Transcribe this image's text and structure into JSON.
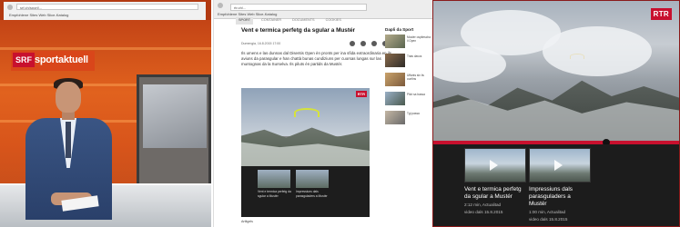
{
  "panel1": {
    "browser": {
      "url": "srf.ch/sport/...",
      "bookmarks": "Empfohlene Sites   Web Slice-Katalog"
    },
    "logo": {
      "brand": "SRF",
      "product": "sportaktuell"
    }
  },
  "panel2": {
    "browser": {
      "url": "rtr.ch/...",
      "bookmarks": "Empfohlene Sites   Web Slice-Katalog"
    },
    "nav": [
      "SPORT",
      "CONTAINER",
      "DOCUMENTS",
      "COOKIES"
    ],
    "article": {
      "headline": "Vent e termica perfetg da sgular a Mustér",
      "meta": "Dumengia, 16.8.2015 17:00",
      "body": "Ils umens e las dunnas dal Disentis Open èn pronts per ina sfida extraordinaria en ils aviuns da parasgular e han chattà bunas cundiziuns per cuorsas lungas sur las muntognas da la Surselva. Ils piluts èn partids da Mustér."
    },
    "video": {
      "badge": "RTR"
    },
    "related": [
      {
        "label": "Vent e termica perfetg da sgular a Mustér",
        "meta": "2:12 min"
      },
      {
        "label": "Impressiuns dals parasguladers a Mustér",
        "meta": "1:00 min"
      }
    ],
    "sidebar": {
      "heading": "Dapli da Sport",
      "items": [
        "Mustér ospitescha il Open",
        "Trais davos",
        "Uffants sin ils cunfins",
        "Pilot sa bassa",
        "Tgi passa"
      ]
    },
    "footer": "Artitgels"
  },
  "panel3": {
    "badge": "RTR",
    "progress": 0.7,
    "cards": [
      {
        "title": "Vent e termica perfetg da sgular a Mustér",
        "duration": "2:12 min, Actualitad",
        "date": "video dals 15.8.2015"
      },
      {
        "title": "Impressiuns dals parasguladers a Mustér",
        "duration": "1:00 min, Actualitad",
        "date": "video dals 15.8.2015"
      }
    ]
  },
  "colors": {
    "srf_red": "#c8102e",
    "studio_orange": "#e1621e",
    "rtr_red": "#c8102e"
  }
}
